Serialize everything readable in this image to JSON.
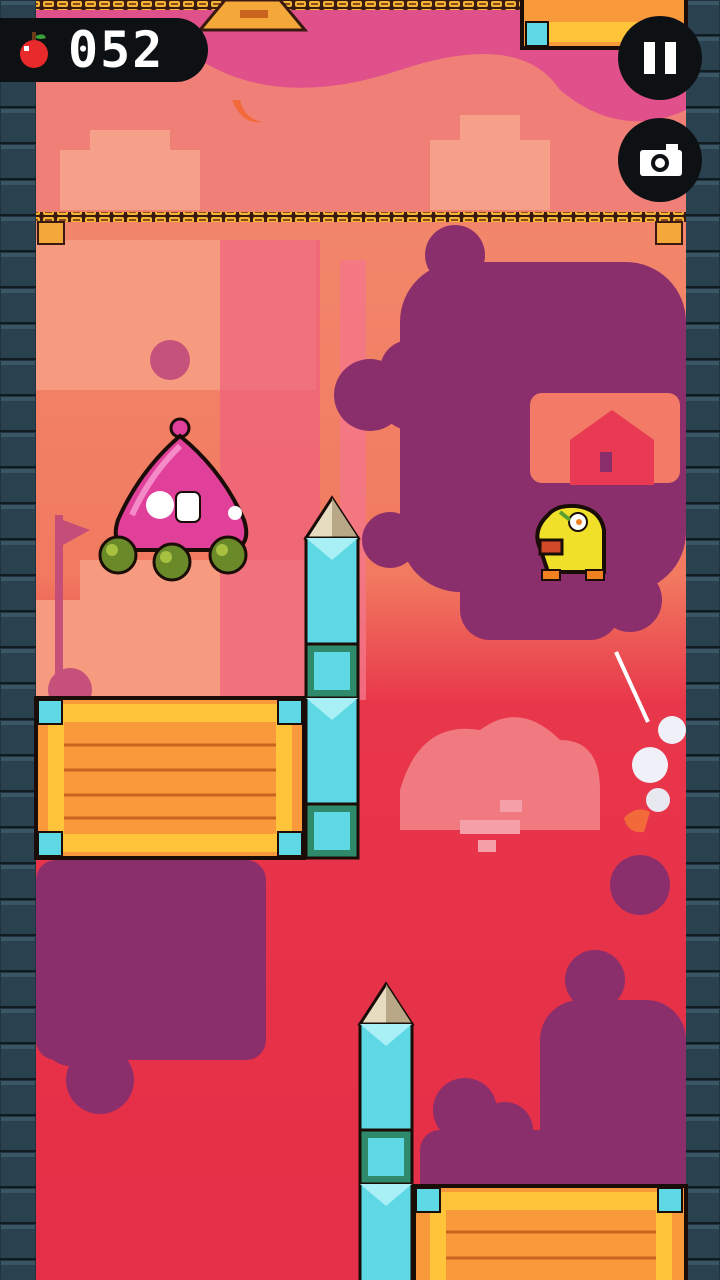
{
  "hud": {
    "score": "052",
    "apple_icon": "apple-icon",
    "pause_icon": "pause-icon",
    "camera_icon": "camera-icon"
  },
  "colors": {
    "sky_upper": "#f5876f",
    "sky_mid": "#f0795e",
    "sky_lower": "#e8304a",
    "purple_silhouette": "#8c2f6e",
    "crate_orange": "#f89a3c",
    "crate_frame": "#ffc43a",
    "spike_cyan": "#5fd8e6",
    "enemy_pink": "#e0409a",
    "player_yellow": "#f0e02a",
    "wall_tile": "#20323a"
  }
}
